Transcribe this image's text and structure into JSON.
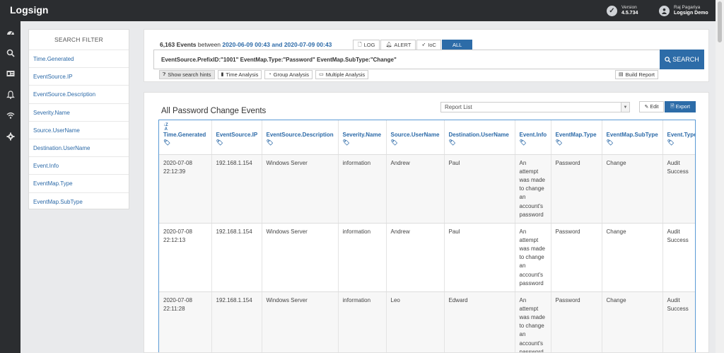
{
  "app": {
    "logo": "Logsign",
    "version_label": "Version",
    "version": "4.5.734",
    "user_name": "Raj Pagariya",
    "user_org": "Logsign Demo"
  },
  "nav": {
    "icons": [
      "dashboard-icon",
      "search-icon",
      "id-card-icon",
      "bell-icon",
      "wifi-icon",
      "gear-icon"
    ]
  },
  "filter": {
    "title": "SEARCH FILTER",
    "items": [
      "Time.Generated",
      "EventSource.IP",
      "EventSource.Description",
      "Severity.Name",
      "Source.UserName",
      "Destination.UserName",
      "Event.Info",
      "EventMap.Type",
      "EventMap.SubType"
    ]
  },
  "search": {
    "count": "6,163 Events",
    "between": "between",
    "range": "2020-06-09 00:43 and 2020-07-09 00:43",
    "tabs": {
      "log": "LOG",
      "alert": "ALERT",
      "ioc": "IoC",
      "all": "ALL"
    },
    "query": "EventSource.PrefixID:\"1001\" EventMap.Type:\"Password\" EventMap.SubType:\"Change\"",
    "search_button": "SEARCH",
    "tools": {
      "hints": "Show search hints",
      "time": "Time Analysis",
      "group": "Group Analysis",
      "multiple": "Multiple Analysis",
      "build": "Build Report"
    }
  },
  "report": {
    "title": "All Password Change Events",
    "select_value": "Report List",
    "edit": "Edit",
    "export": "Export",
    "columns": [
      "Time.Generated",
      "EventSource.IP",
      "EventSource.Description",
      "Severity.Name",
      "Source.UserName",
      "Destination.UserName",
      "Event.Info",
      "EventMap.Type",
      "EventMap.SubType",
      "Event.Type"
    ],
    "rows": [
      {
        "date": "2020-07-08",
        "time": "22:12:39",
        "ip": "192.168.1.154",
        "desc": "Windows Server",
        "severity": "information",
        "src_user": "Andrew",
        "dst_user": "Paul",
        "info": [
          "An",
          "attempt",
          "was made",
          "to change",
          "an",
          "account's",
          "password"
        ],
        "map_type": "Password",
        "map_subtype": "Change",
        "event_type": [
          "Audit",
          "Success"
        ]
      },
      {
        "date": "2020-07-08",
        "time": "22:12:13",
        "ip": "192.168.1.154",
        "desc": "Windows Server",
        "severity": "information",
        "src_user": "Andrew",
        "dst_user": "Paul",
        "info": [
          "An",
          "attempt",
          "was made",
          "to change",
          "an",
          "account's",
          "password"
        ],
        "map_type": "Password",
        "map_subtype": "Change",
        "event_type": [
          "Audit",
          "Success"
        ]
      },
      {
        "date": "2020-07-08",
        "time": "22:11:28",
        "ip": "192.168.1.154",
        "desc": "Windows Server",
        "severity": "information",
        "src_user": "Leo",
        "dst_user": "Edward",
        "info": [
          "An",
          "attempt",
          "was made",
          "to change",
          "an",
          "account's",
          "password"
        ],
        "map_type": "Password",
        "map_subtype": "Change",
        "event_type": [
          "Audit",
          "Success"
        ]
      }
    ]
  }
}
